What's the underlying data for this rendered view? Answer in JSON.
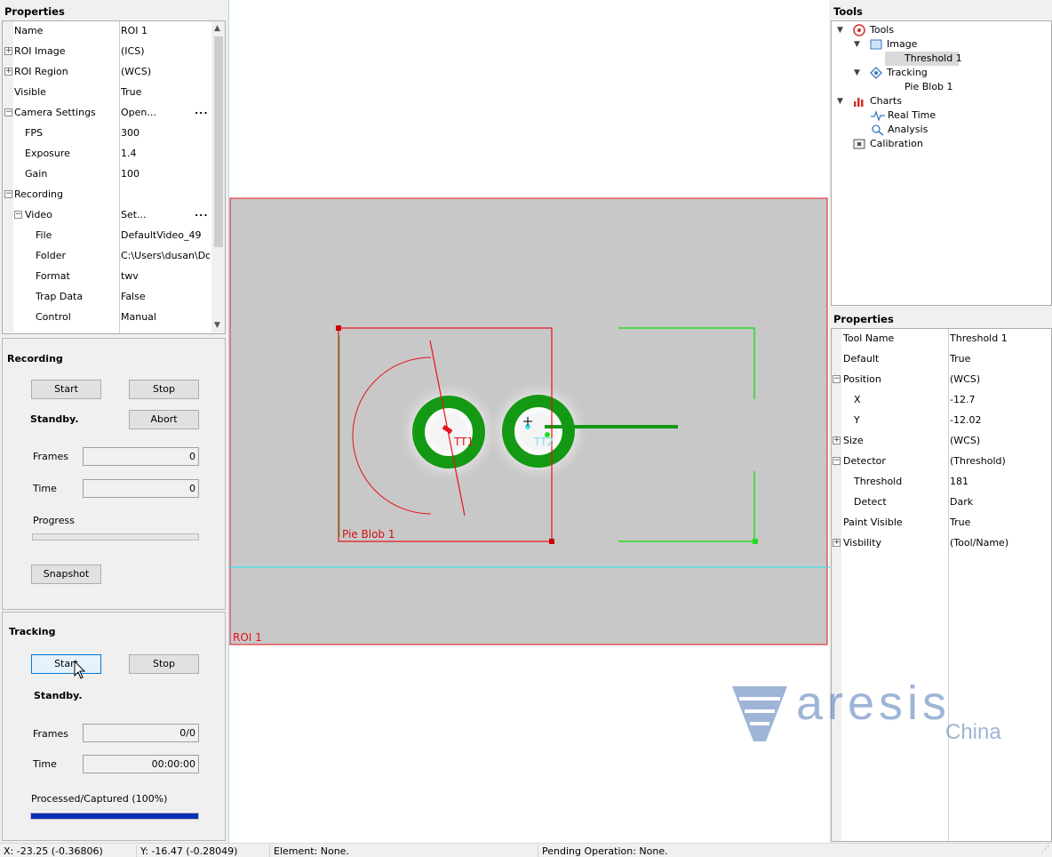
{
  "left_properties": {
    "title": "Properties",
    "rows": [
      {
        "name": "Name",
        "value": "ROI 1"
      },
      {
        "name": "ROI Image",
        "value": "(ICS)",
        "expander": "+"
      },
      {
        "name": "ROI Region",
        "value": "(WCS)",
        "expander": "+"
      },
      {
        "name": "Visible",
        "value": "True"
      },
      {
        "name": "Camera Settings",
        "value": "Open...",
        "expander": "−",
        "dots": "..."
      },
      {
        "name": "FPS",
        "value": "300"
      },
      {
        "name": "Exposure",
        "value": "1.4"
      },
      {
        "name": "Gain",
        "value": "100"
      },
      {
        "name": "Recording",
        "value": "",
        "expander": "−"
      },
      {
        "name": "Video",
        "value": "Set...",
        "expander": "−",
        "dots": "..."
      },
      {
        "name": "File",
        "value": "DefaultVideo_49"
      },
      {
        "name": "Folder",
        "value": "C:\\Users\\dusan\\Docu"
      },
      {
        "name": "Format",
        "value": "twv"
      },
      {
        "name": "Trap Data",
        "value": "False"
      },
      {
        "name": "Control",
        "value": "Manual"
      }
    ]
  },
  "recording": {
    "title": "Recording",
    "start_label": "Start",
    "stop_label": "Stop",
    "status": "Standby.",
    "abort_label": "Abort",
    "frames_label": "Frames",
    "frames_value": "0",
    "time_label": "Time",
    "time_value": "0",
    "progress_label": "Progress",
    "progress_fraction": 0,
    "snapshot_label": "Snapshot"
  },
  "tracking": {
    "title": "Tracking",
    "start_label": "Start",
    "stop_label": "Stop",
    "status": "Standby.",
    "frames_label": "Frames",
    "frames_value": "0/0",
    "time_label": "Time",
    "time_value": "00:00:00",
    "processed_label": "Processed/Captured (100%)",
    "processed_fraction": 1.0
  },
  "viewport": {
    "roi_label": "ROI 1",
    "blob_label": "Pie Blob 1",
    "target1_label": "TT1",
    "target2_label": "TT2"
  },
  "tools": {
    "title": "Tools",
    "tree": {
      "root": "Tools",
      "image": "Image",
      "threshold": "Threshold 1",
      "tracking": "Tracking",
      "pie_blob": "Pie Blob 1",
      "charts": "Charts",
      "real_time": "Real Time",
      "analysis": "Analysis",
      "calibration": "Calibration"
    }
  },
  "right_properties": {
    "title": "Properties",
    "rows": [
      {
        "name": "Tool Name",
        "value": "Threshold 1"
      },
      {
        "name": "Default",
        "value": "True"
      },
      {
        "name": "Position",
        "value": "(WCS)",
        "expander": "−"
      },
      {
        "name": "X",
        "value": "-12.7"
      },
      {
        "name": "Y",
        "value": "-12.02"
      },
      {
        "name": "Size",
        "value": "(WCS)",
        "expander": "+"
      },
      {
        "name": "Detector",
        "value": "(Threshold)",
        "expander": "−"
      },
      {
        "name": "Threshold",
        "value": "181"
      },
      {
        "name": "Detect",
        "value": "Dark"
      },
      {
        "name": "Paint Visible",
        "value": "True"
      },
      {
        "name": "Visbility",
        "value": "(Tool/Name)",
        "expander": "+"
      }
    ]
  },
  "watermark": {
    "brand": "aresis",
    "sub": "China"
  },
  "status_bar": {
    "x": "X: -23.25   (-0.36806)",
    "y": "Y: -16.47   (-0.28049)",
    "element": "Element: None.",
    "pending": "Pending Operation: None."
  },
  "colors": {
    "accent": "#0078d7",
    "roi_red": "#e8101a",
    "blob_green": "#119911",
    "cyan": "#40e0e8"
  }
}
